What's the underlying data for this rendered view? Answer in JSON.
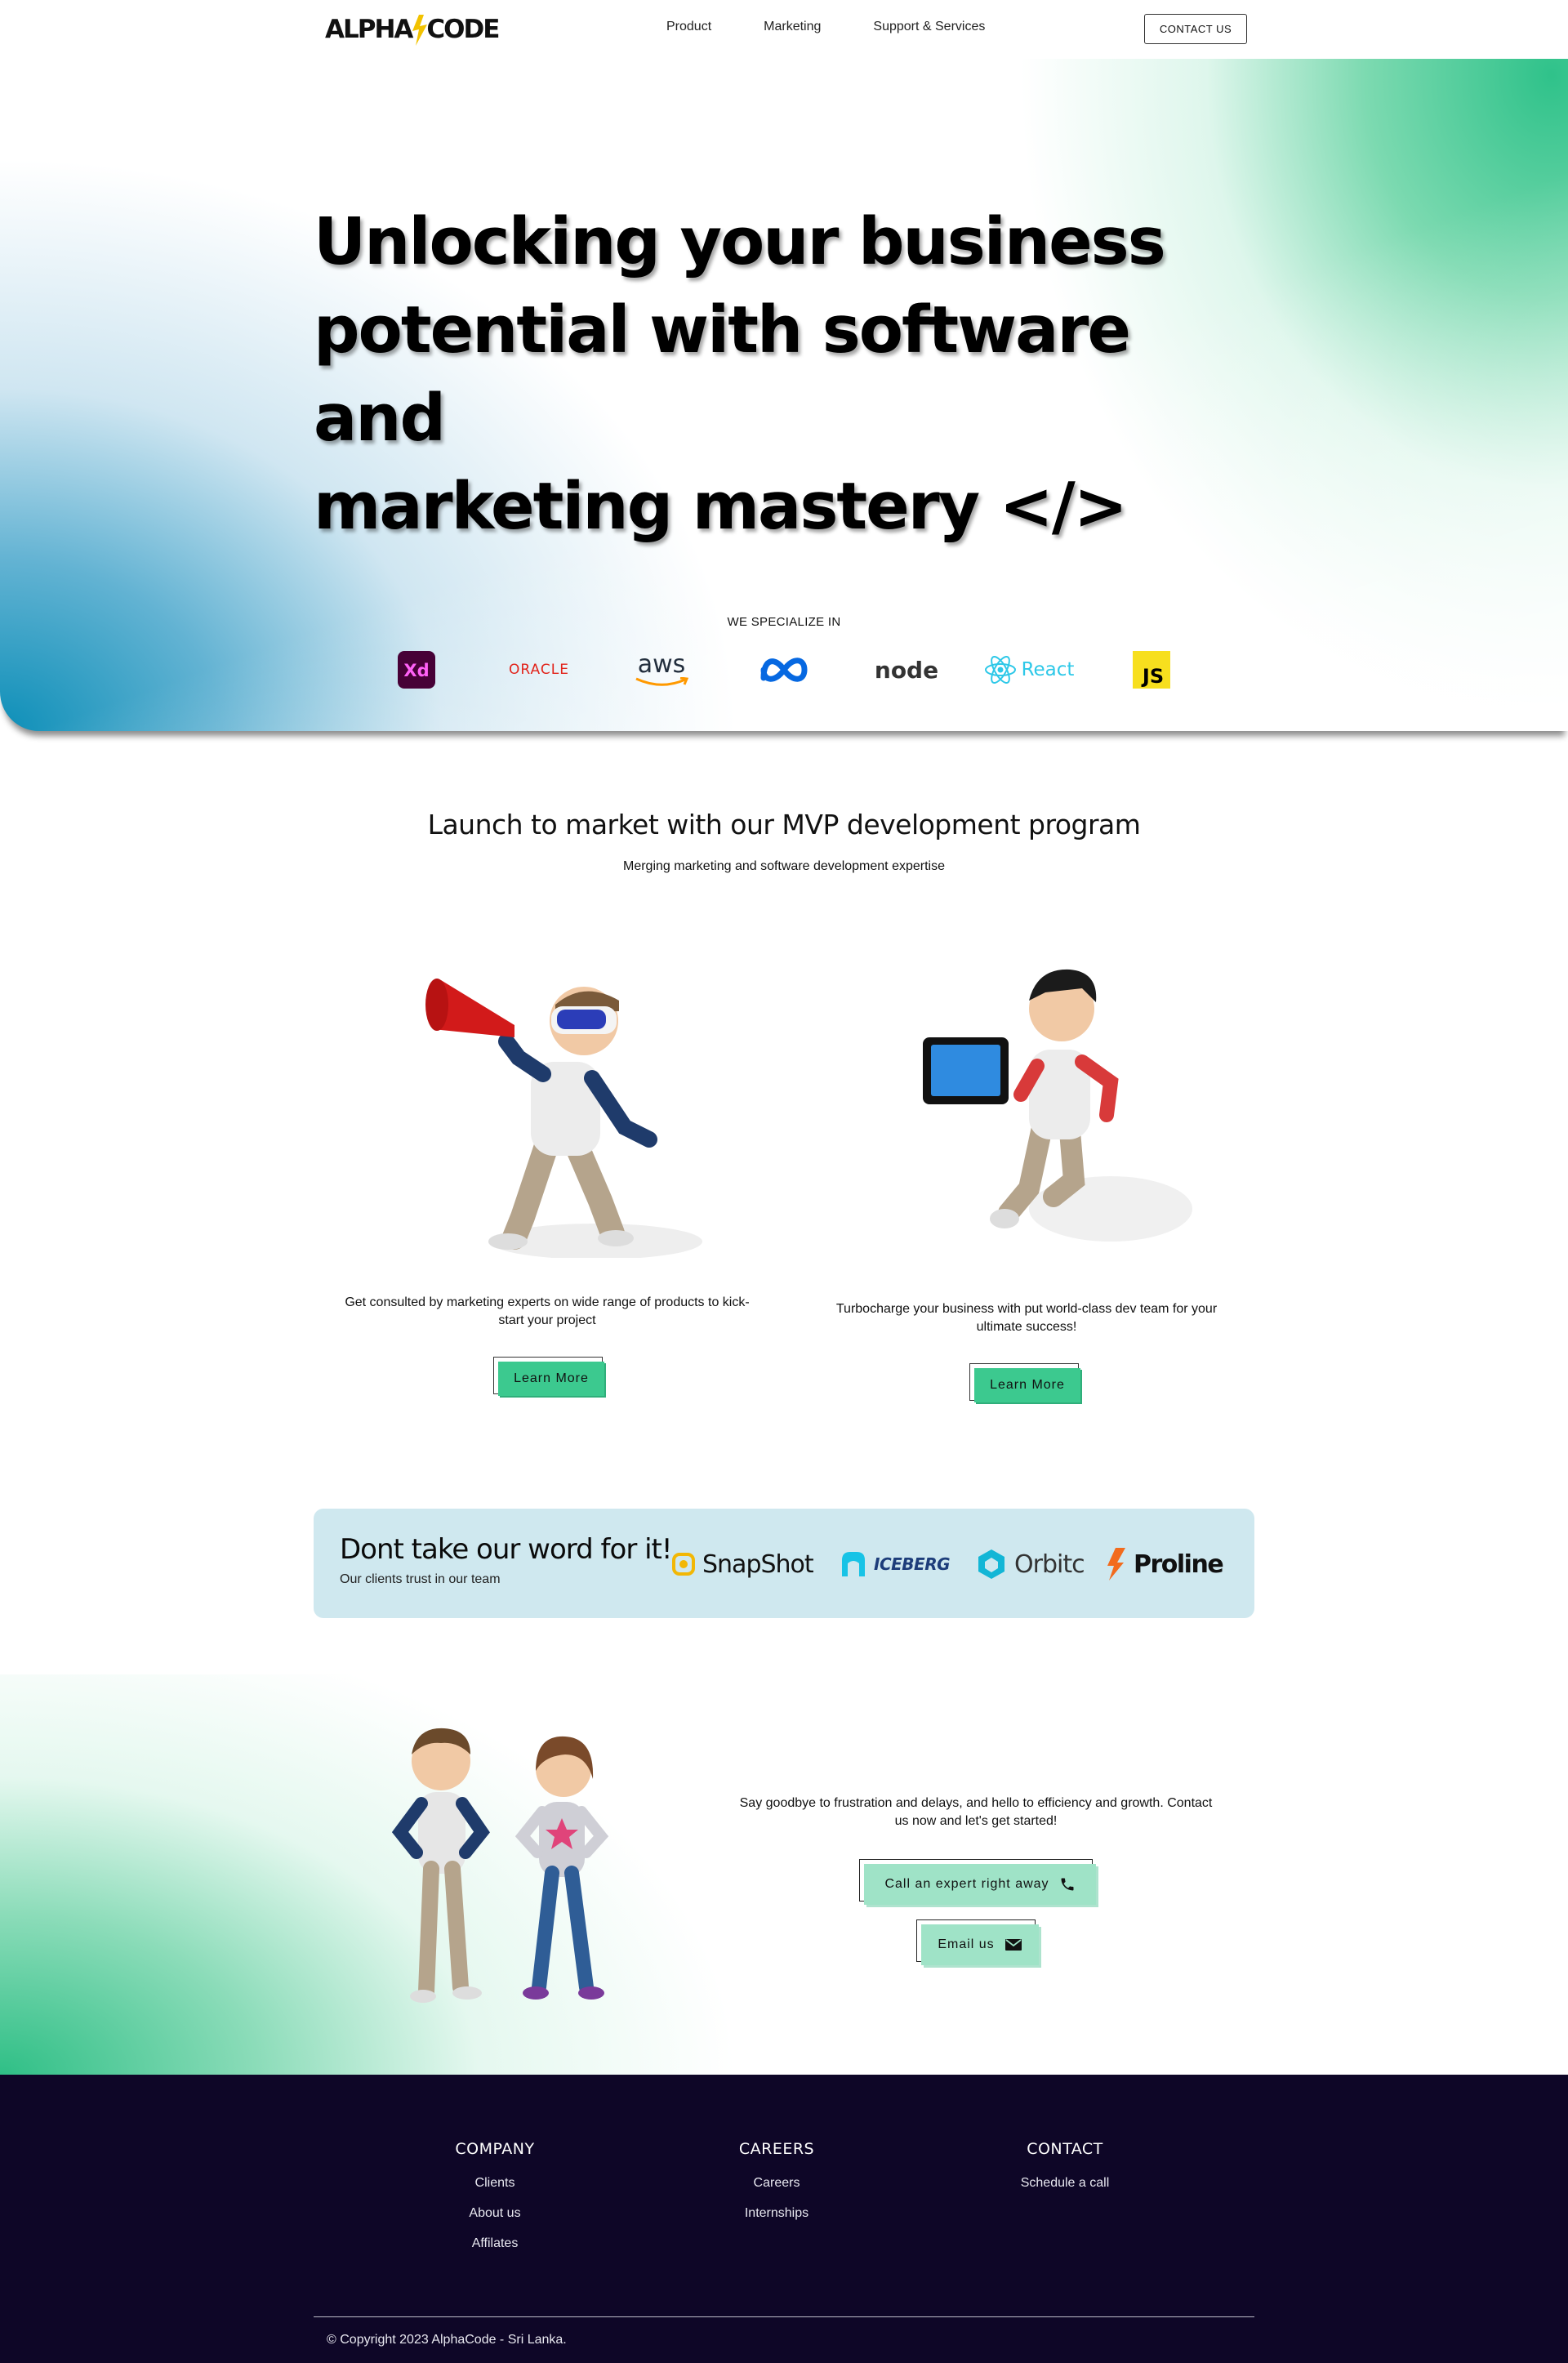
{
  "nav": {
    "logo": "ALPHACODE",
    "links": [
      "Product",
      "Marketing",
      "Support & Services"
    ],
    "contact": "CONTACT US"
  },
  "hero": {
    "title_line1": "Unlocking your business",
    "title_line2": "potential with software and",
    "title_line3": "marketing mastery </>",
    "specialize_label": "WE SPECIALIZE IN",
    "tech_logos": [
      "Xd",
      "ORACLE",
      "aws",
      "Meta",
      "node",
      "React",
      "JS"
    ]
  },
  "mvp": {
    "title": "Launch to market with our MVP development program",
    "subtitle": "Merging marketing and software development expertise",
    "cards": [
      {
        "text": "Get consulted by marketing experts on wide range of products to kick-start your project",
        "button": "Learn More"
      },
      {
        "text": "Turbocharge your business with put world-class dev team for your ultimate success!",
        "button": "Learn More"
      }
    ]
  },
  "clients": {
    "title": "Dont take our word for it!",
    "subtitle": "Our clients trust in our team",
    "logos": [
      "SnapShot",
      "ICEBERG",
      "Orbitc",
      "Proline"
    ]
  },
  "cta": {
    "text": "Say goodbye to frustration and delays, and hello to efficiency and growth. Contact us now and let's get started!",
    "call_button": "Call an expert right away",
    "email_button": "Email us"
  },
  "footer": {
    "columns": [
      {
        "title": "COMPANY",
        "items": [
          "Clients",
          "About us",
          "Affilates"
        ]
      },
      {
        "title": "CAREERS",
        "items": [
          "Careers",
          "Internships"
        ]
      },
      {
        "title": "CONTACT",
        "items": [
          "Schedule a call"
        ]
      }
    ],
    "copyright": "© Copyright 2023 AlphaCode - Sri Lanka."
  },
  "colors": {
    "accent_green": "#3cc98f",
    "hero_teal": "#0d8fb8",
    "clients_bg": "#cfe8ef",
    "footer_bg": "#0e0627"
  }
}
